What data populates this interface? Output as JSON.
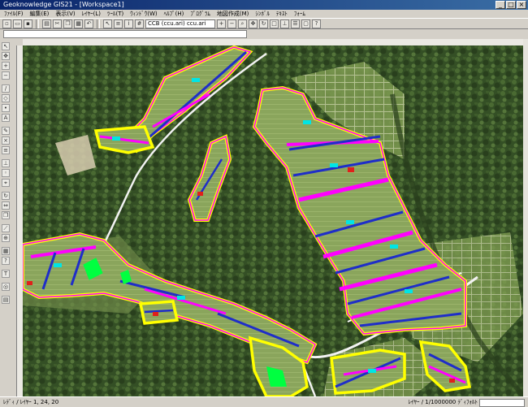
{
  "window": {
    "title": "Geoknowledge GIS21 - [Workspace1]",
    "controls": [
      "_",
      "□",
      "×"
    ]
  },
  "menu": {
    "items": [
      "ﾌｧｲﾙ(F)",
      "編集(E)",
      "表示(V)",
      "ﾚｲﾔｰ(L)",
      "ﾂｰﾙ(T)",
      "ｳｨﾝﾄﾞｳ(W)",
      "ﾍﾙﾌﾟ(H)",
      "ﾌﾟﾛｸﾞﾗﾑ",
      "地図作成(M)",
      "ｼﾝﾎﾞﾙ",
      "ﾃｷｽﾄ",
      "ﾌｫｰﾑ"
    ]
  },
  "toolbar": {
    "layer_combo": "CCB (ccu.ari) ccu.ari"
  },
  "status": {
    "left": "ﾚﾃﾞｨ / ﾚｲﾔｰ 1, 24, 20",
    "right": "ﾚｲﾔｰ / 1/1000000 ﾃﾞｨﾌｫﾙﾄ"
  },
  "colors": {
    "forest": "#2f4a22",
    "field": "#88a35a",
    "road": "#f2f2f2",
    "parcel_outline": "#ffff00",
    "parcel_fill": "#ff00ff",
    "canal": "#1f2ec8",
    "label": "#00e5e5"
  },
  "icons": {
    "tool_left": [
      "arrow-icon",
      "pan-icon",
      "zoom-in-icon",
      "zoom-out-icon",
      "line-icon",
      "polygon-icon",
      "point-icon",
      "text-icon",
      "edit-icon",
      "delete-icon",
      "layer-icon",
      "measure-icon"
    ]
  }
}
